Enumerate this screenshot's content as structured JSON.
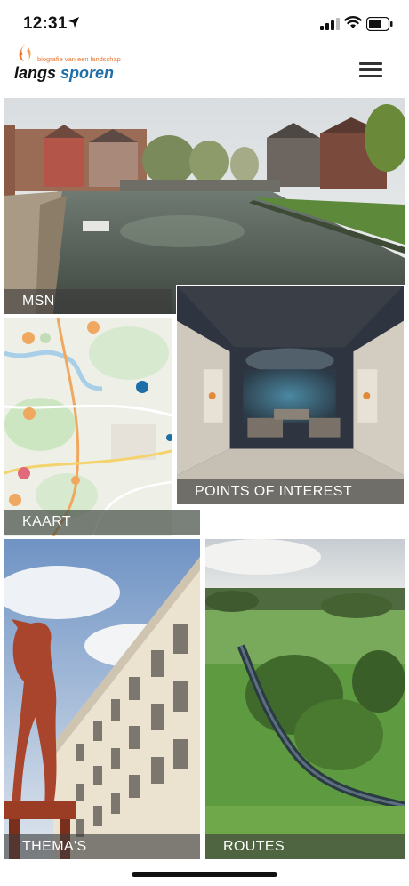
{
  "status_bar": {
    "time": "12:31"
  },
  "header": {
    "logo_tagline": "biografie van een landschap",
    "logo_word_1": "langs",
    "logo_word_2": "sporen",
    "menu_icon": "hamburger-menu-icon"
  },
  "tiles": {
    "msn": {
      "label": "MSN"
    },
    "kaart": {
      "label": "KAART"
    },
    "poi": {
      "label": "POINTS OF INTEREST"
    },
    "themas": {
      "label": "THEMA'S"
    },
    "routes": {
      "label": "ROUTES"
    }
  },
  "colors": {
    "brand_orange": "#e8742c",
    "brand_blue": "#1e6ea8",
    "label_overlay": "#3c3c3c"
  }
}
